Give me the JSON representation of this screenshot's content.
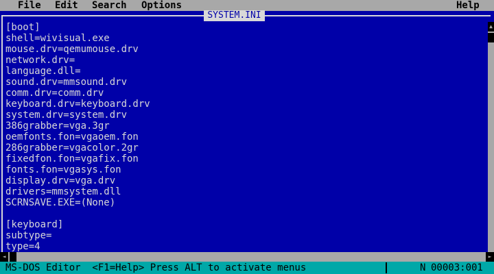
{
  "menu": {
    "file": "File",
    "edit": "Edit",
    "search": "Search",
    "options": "Options",
    "help": "Help"
  },
  "document": {
    "title": "SYSTEM.INI",
    "lines": [
      "[boot]",
      "shell=wivisual.exe",
      "mouse.drv=qemumouse.drv",
      "network.drv=",
      "language.dll=",
      "sound.drv=mmsound.drv",
      "comm.drv=comm.drv",
      "keyboard.drv=keyboard.drv",
      "system.drv=system.drv",
      "386grabber=vga.3gr",
      "oemfonts.fon=vgaoem.fon",
      "286grabber=vgacolor.2gr",
      "fixedfon.fon=vgafix.fon",
      "fonts.fon=vgasys.fon",
      "display.drv=vga.drv",
      "drivers=mmsystem.dll",
      "SCRNSAVE.EXE=(None)",
      "",
      "[keyboard]",
      "subtype=",
      "type=4"
    ]
  },
  "status": {
    "left": "MS-DOS Editor  <F1=Help> Press ALT to activate menus",
    "mode": "N",
    "position": "00003:001"
  },
  "colors": {
    "background": "#0000a8",
    "text": "#d8d8d8",
    "menubar": "#a8a8a8",
    "statusbar": "#00a8a8"
  }
}
